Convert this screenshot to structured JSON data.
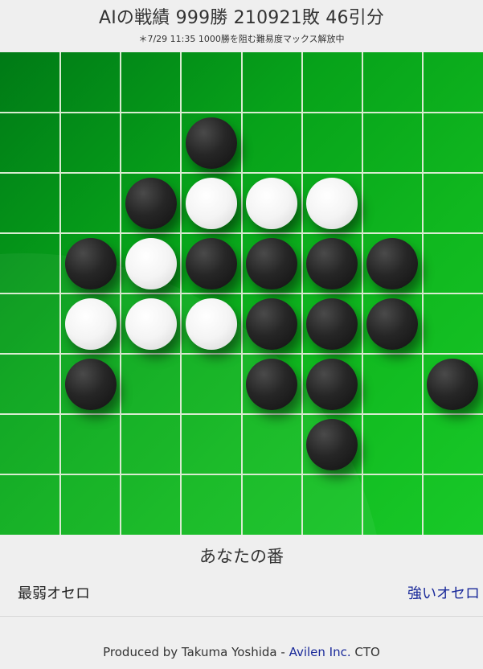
{
  "header": {
    "title": "AIの戦績 999勝 210921敗 46引分",
    "note": "＊7/29 11:35 1000勝を阻む難易度マックス解放中"
  },
  "board": {
    "size": 8,
    "cells": [
      {
        "row": 1,
        "col": 3,
        "color": "black"
      },
      {
        "row": 2,
        "col": 2,
        "color": "black"
      },
      {
        "row": 2,
        "col": 3,
        "color": "white"
      },
      {
        "row": 2,
        "col": 4,
        "color": "white"
      },
      {
        "row": 2,
        "col": 5,
        "color": "white"
      },
      {
        "row": 3,
        "col": 1,
        "color": "black"
      },
      {
        "row": 3,
        "col": 2,
        "color": "white"
      },
      {
        "row": 3,
        "col": 3,
        "color": "black"
      },
      {
        "row": 3,
        "col": 4,
        "color": "black"
      },
      {
        "row": 3,
        "col": 5,
        "color": "black"
      },
      {
        "row": 3,
        "col": 6,
        "color": "black"
      },
      {
        "row": 4,
        "col": 1,
        "color": "white"
      },
      {
        "row": 4,
        "col": 2,
        "color": "white"
      },
      {
        "row": 4,
        "col": 3,
        "color": "white"
      },
      {
        "row": 4,
        "col": 4,
        "color": "black"
      },
      {
        "row": 4,
        "col": 5,
        "color": "black"
      },
      {
        "row": 4,
        "col": 6,
        "color": "black"
      },
      {
        "row": 5,
        "col": 1,
        "color": "black"
      },
      {
        "row": 5,
        "col": 4,
        "color": "black"
      },
      {
        "row": 5,
        "col": 5,
        "color": "black"
      },
      {
        "row": 5,
        "col": 7,
        "color": "black"
      },
      {
        "row": 6,
        "col": 5,
        "color": "black"
      }
    ]
  },
  "status": {
    "turn": "あなたの番"
  },
  "links": {
    "weakest": "最弱オセロ",
    "strong": "強いオセロ"
  },
  "footer": {
    "prefix": "Produced by Takuma Yoshida - ",
    "company": "Avilen Inc.",
    "suffix": " CTO"
  },
  "colors": {
    "board_green": "#10b81f",
    "link_blue": "#1a2a9a"
  }
}
